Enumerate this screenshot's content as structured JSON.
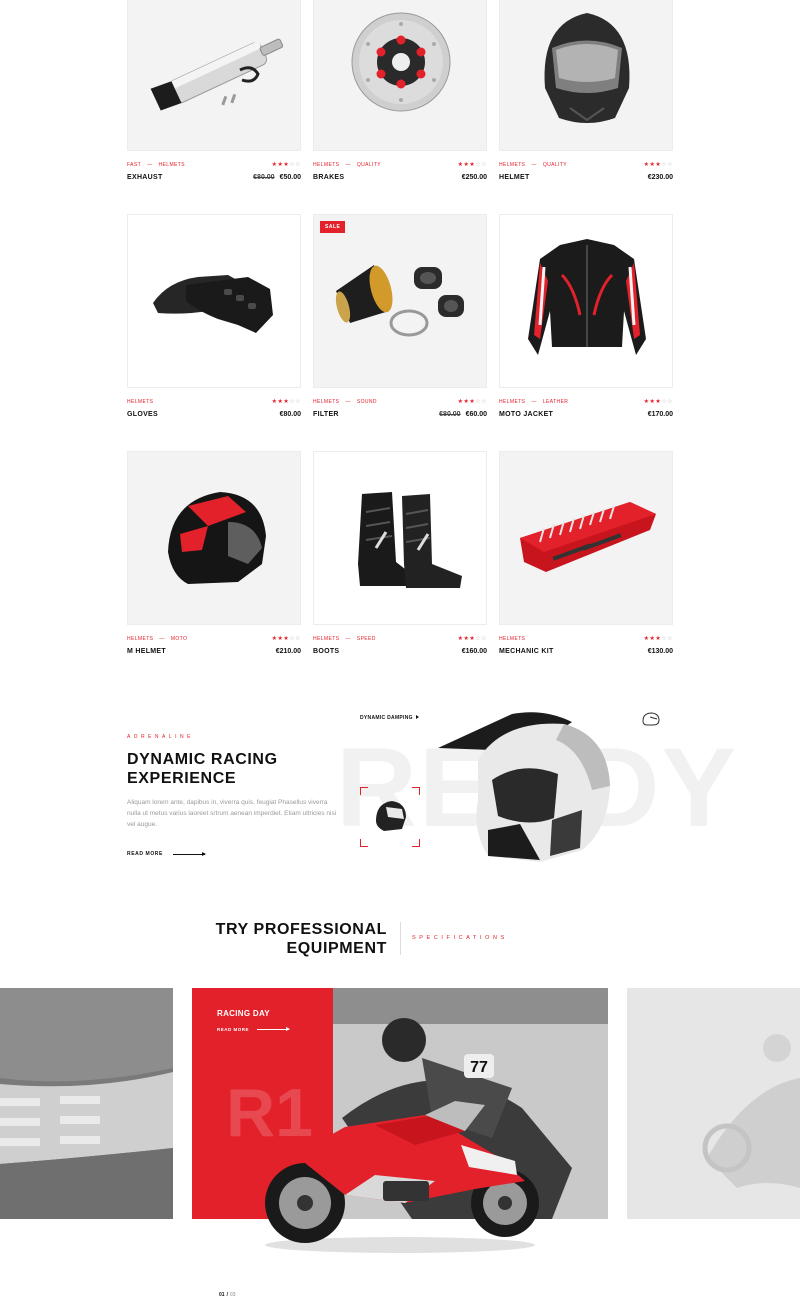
{
  "products": [
    {
      "name": "EXHAUST",
      "cats": [
        "FAST",
        "HELMETS"
      ],
      "old_price": "€80.00",
      "price": "€50.00",
      "stars": 3,
      "sale": false,
      "icon": "exhaust-icon"
    },
    {
      "name": "BRAKES",
      "cats": [
        "HELMETS",
        "QUALITY"
      ],
      "old_price": "",
      "price": "€250.00",
      "stars": 3,
      "sale": false,
      "icon": "brake-disc-icon"
    },
    {
      "name": "HELMET",
      "cats": [
        "HELMETS",
        "QUALITY"
      ],
      "old_price": "",
      "price": "€230.00",
      "stars": 3,
      "sale": false,
      "icon": "helmet-icon"
    },
    {
      "name": "GLOVES",
      "cats": [
        "HELMETS"
      ],
      "old_price": "",
      "price": "€80.00",
      "stars": 3,
      "sale": false,
      "icon": "gloves-icon"
    },
    {
      "name": "FILTER",
      "cats": [
        "HELMETS",
        "SOUND"
      ],
      "old_price": "€80.00",
      "price": "€60.00",
      "stars": 3,
      "sale": true,
      "sale_label": "SALE",
      "icon": "air-filter-icon"
    },
    {
      "name": "MOTO JACKET",
      "cats": [
        "HELMETS",
        "LEATHER"
      ],
      "old_price": "",
      "price": "€170.00",
      "stars": 3,
      "sale": false,
      "icon": "jacket-icon"
    },
    {
      "name": "M HELMET",
      "cats": [
        "HELMETS",
        "MOTO"
      ],
      "old_price": "",
      "price": "€210.00",
      "stars": 3,
      "sale": false,
      "icon": "red-helmet-icon"
    },
    {
      "name": "BOOTS",
      "cats": [
        "HELMETS",
        "SPEED"
      ],
      "old_price": "",
      "price": "€160.00",
      "stars": 3,
      "sale": false,
      "icon": "boots-icon"
    },
    {
      "name": "MECHANIC KIT",
      "cats": [
        "HELMETS"
      ],
      "old_price": "",
      "price": "€130.00",
      "stars": 3,
      "sale": false,
      "icon": "tool-kit-icon"
    }
  ],
  "promo": {
    "kicker": "ADRENALINE",
    "title_line1": "DYNAMIC RACING",
    "title_line2": "EXPERIENCE",
    "text": "Aliquam lorem ante, dapibus in, viverra quis, feugiat Phasellus viverra nulla ut metus varius laoreet srtrum aenean imperdiet. Etiam ultricies nisi vel augue.",
    "read_more": "READ MORE",
    "bg_word": "READY",
    "damping_label": "DYNAMIC DAMPING"
  },
  "section": {
    "title_line1": "TRY PROFESSIONAL",
    "title_line2": "EQUIPMENT",
    "kicker": "SPECIFICATIONS"
  },
  "slider": {
    "slide_title": "RACING DAY",
    "read_more": "READ MORE",
    "number_plate": "77",
    "bg_text": "R1",
    "current": "01",
    "total": "03"
  },
  "colors": {
    "accent": "#e3212b",
    "text": "#111111",
    "muted": "#9a9a9a",
    "card_bg": "#f3f3f3"
  }
}
